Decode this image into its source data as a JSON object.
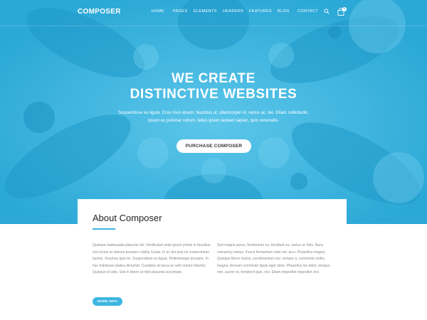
{
  "brand": {
    "name": "COMPOSER",
    "accent": "#3cb6e0"
  },
  "nav": {
    "items": [
      {
        "label": "HOME"
      },
      {
        "label": "PAGES"
      },
      {
        "label": "ELEMENTS"
      },
      {
        "label": "HEADERS"
      },
      {
        "label": "FEATURES"
      },
      {
        "label": "BLOG"
      },
      {
        "label": "CONTACT"
      }
    ],
    "search_icon": "search-icon",
    "cart_icon": "cart-icon",
    "cart_count": "0"
  },
  "hero": {
    "title_line1": "WE CREATE",
    "title_line2": "DISTINCTIVE WEBSITES",
    "subtitle": "Suspendisse eu ligula. Cras risus ipsum, faucibus ut, ullamcorper id, varius ac, leo. Etiam sollicitudin, ipsum eu pulvinar rutrum, tellus ipsum laoreet sapien, quis venenatis.",
    "cta_label": "PURCHASE COMPOSER"
  },
  "about": {
    "title": "About Composer",
    "col_left": "Quisque malesuada placerat nisl. Vestibulum ante ipsum primis in faucibus orci luctus et ultrices posuere cubilia Curae; In ac dui quis mi consectetuer lacinia. Vivamus quis mi. Suspendisse eu ligula. Pellentesque posuere. In hac habitasse platea dictumst. Curabitur at lacus ac velit ornare lobortis. Quisque id odio. Sed in libero ut nibh placerat accumsan.",
    "col_right": "Sed magna purus, fermentum eu, tincidunt eu, varius ut, felis. Nunc nonummy metus. Fusce fermentum odio nec arcu. Phasellus magna. Quisque libero metus, condimentum nec, tempor a, commodo mollis, magna. Aenean commodo ligula eget dolor. Phasellus leo dolor, tempus non, auctor et, hendrerit quis, nisi. Etiam imperdiet imperdiet orci.",
    "more_label": "MORE INFO"
  }
}
